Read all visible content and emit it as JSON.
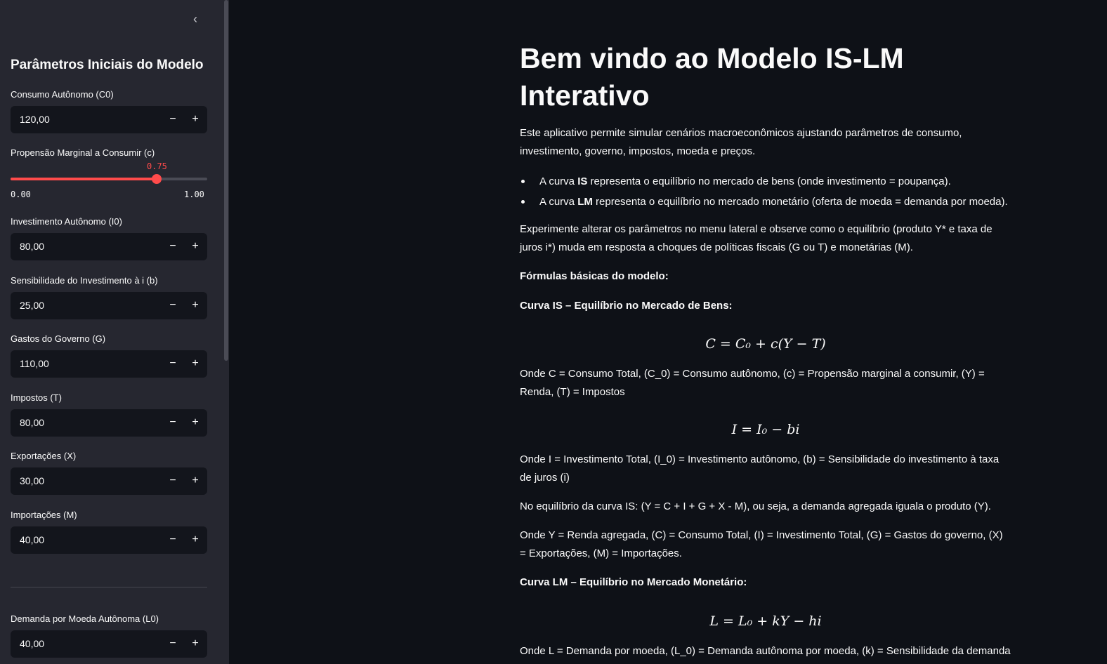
{
  "sidebar": {
    "collapse_icon": "chevron-left",
    "title": "Parâmetros Iniciais do Modelo",
    "inputs": [
      {
        "label": "Consumo Autônomo (C0)",
        "value": "120,00"
      },
      {
        "label": "Investimento Autônomo (I0)",
        "value": "80,00"
      },
      {
        "label": "Sensibilidade do Investimento à i (b)",
        "value": "25,00"
      },
      {
        "label": "Gastos do Governo (G)",
        "value": "110,00"
      },
      {
        "label": "Impostos (T)",
        "value": "80,00"
      },
      {
        "label": "Exportações (X)",
        "value": "30,00"
      },
      {
        "label": "Importações (M)",
        "value": "40,00"
      },
      {
        "label": "Demanda por Moeda Autônoma (L0)",
        "value": "40,00"
      }
    ],
    "minus_symbol": "−",
    "plus_symbol": "+",
    "slider": {
      "label": "Propensão Marginal a Consumir (c)",
      "value_text": "0.75",
      "value": 0.75,
      "min_text": "0.00",
      "max_text": "1.00",
      "min": 0,
      "max": 1,
      "color": "#ff4b4b"
    }
  },
  "main": {
    "title": "Bem vindo ao Modelo IS-LM Interativo",
    "intro": "Este aplicativo permite simular cenários macroeconômicos ajustando parâmetros de consumo, investimento, governo, impostos, moeda e preços.",
    "bullets": [
      {
        "pre": "A curva ",
        "bold": "IS",
        "post": " representa o equilíbrio no mercado de bens (onde investimento = poupança)."
      },
      {
        "pre": "A curva ",
        "bold": "LM",
        "post": " representa o equilíbrio no mercado monetário (oferta de moeda = demanda por moeda)."
      }
    ],
    "experiment": "Experimente alterar os parâmetros no menu lateral e observe como o equilíbrio (produto Y* e taxa de juros i*) muda em resposta a choques de políticas fiscais (G ou T) e monetárias (M).",
    "formulas_heading": "Fórmulas básicas do modelo:",
    "is_heading": "Curva IS – Equilíbrio no Mercado de Bens:",
    "eq_consumption": "C = C₀ + c(Y − T)",
    "consumption_desc": "Onde C = Consumo Total, (C_0) = Consumo autônomo, (c) = Propensão marginal a consumir, (Y) = Renda, (T) = Impostos",
    "eq_investment": "I = I₀ − bi",
    "investment_desc": "Onde I = Investimento Total, (I_0) = Investimento autônomo, (b) = Sensibilidade do investimento à taxa de juros (i)",
    "is_equilibrium": "No equilíbrio da curva IS: (Y = C + I + G + X - M), ou seja, a demanda agregada iguala o produto (Y).",
    "is_vars": "Onde Y = Renda agregada, (C) = Consumo Total, (I) = Investimento Total, (G) = Gastos do governo, (X) = Exportações, (M) = Importações.",
    "lm_heading": "Curva LM – Equilíbrio no Mercado Monetário:",
    "eq_money": "L = L₀ + kY − hi",
    "money_desc": "Onde L = Demanda por moeda, (L_0) = Demanda autônoma por moeda, (k) = Sensibilidade da demanda"
  }
}
